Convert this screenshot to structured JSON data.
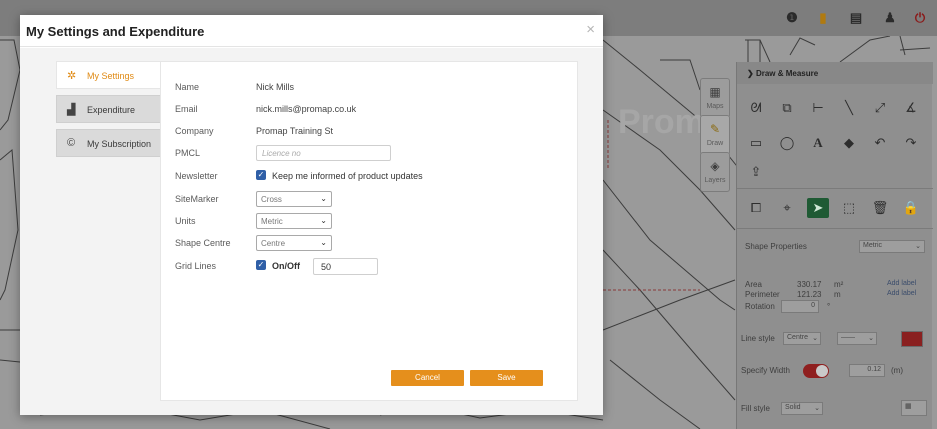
{
  "modal": {
    "title": "My Settings and Expenditure",
    "close": "×",
    "tabs": [
      {
        "label": "My Settings",
        "icon": "gear-icon",
        "active": true
      },
      {
        "label": "Expenditure",
        "icon": "bar-chart-icon",
        "active": false
      },
      {
        "label": "My Subscription",
        "icon": "copyright-icon",
        "active": false
      }
    ],
    "fields": {
      "name": {
        "label": "Name",
        "value": "Nick Mills"
      },
      "email": {
        "label": "Email",
        "value": "nick.mills@promap.co.uk"
      },
      "company": {
        "label": "Company",
        "value": "Promap Training St"
      },
      "pmcl": {
        "label": "PMCL",
        "placeholder": "Licence no",
        "value": ""
      },
      "newsletter": {
        "label": "Newsletter",
        "checked": true,
        "text": "Keep me informed of product updates"
      },
      "sitemarker": {
        "label": "SiteMarker",
        "selected": "Cross"
      },
      "units": {
        "label": "Units",
        "selected": "Metric"
      },
      "shape_centre": {
        "label": "Shape Centre",
        "selected": "Centre"
      },
      "grid_lines": {
        "label": "Grid Lines",
        "checked": true,
        "text": "On/Off",
        "value": "50"
      }
    },
    "buttons": {
      "cancel": "Cancel",
      "save": "Save"
    }
  },
  "map": {
    "watermark": "Prom",
    "side_tabs": [
      "Maps",
      "Draw",
      "Layers"
    ]
  },
  "right_panel": {
    "header": "Draw & Measure",
    "shape_properties": "Shape Properties",
    "units_select": "Metric",
    "area_label": "Area",
    "area_value": "330.17",
    "area_unit": "m²",
    "perimeter_label": "Perimeter",
    "perimeter_value": "121.23",
    "perimeter_unit": "m",
    "rotation_label": "Rotation",
    "rotation_value": "0",
    "rotation_unit": "°",
    "add_label_1": "Add label",
    "add_label_2": "Add label",
    "line_style_label": "Line style",
    "line_style_select": "Centre",
    "specify_width_label": "Specify Width",
    "width_value": "0.12",
    "width_unit": "(m)",
    "fill_style_label": "Fill style",
    "fill_style_select": "Solid"
  },
  "colors": {
    "accent": "#e58f1c",
    "checkbox": "#2f5fa7",
    "selected_tool": "#1f5a34",
    "line_color": "#8a2020"
  }
}
